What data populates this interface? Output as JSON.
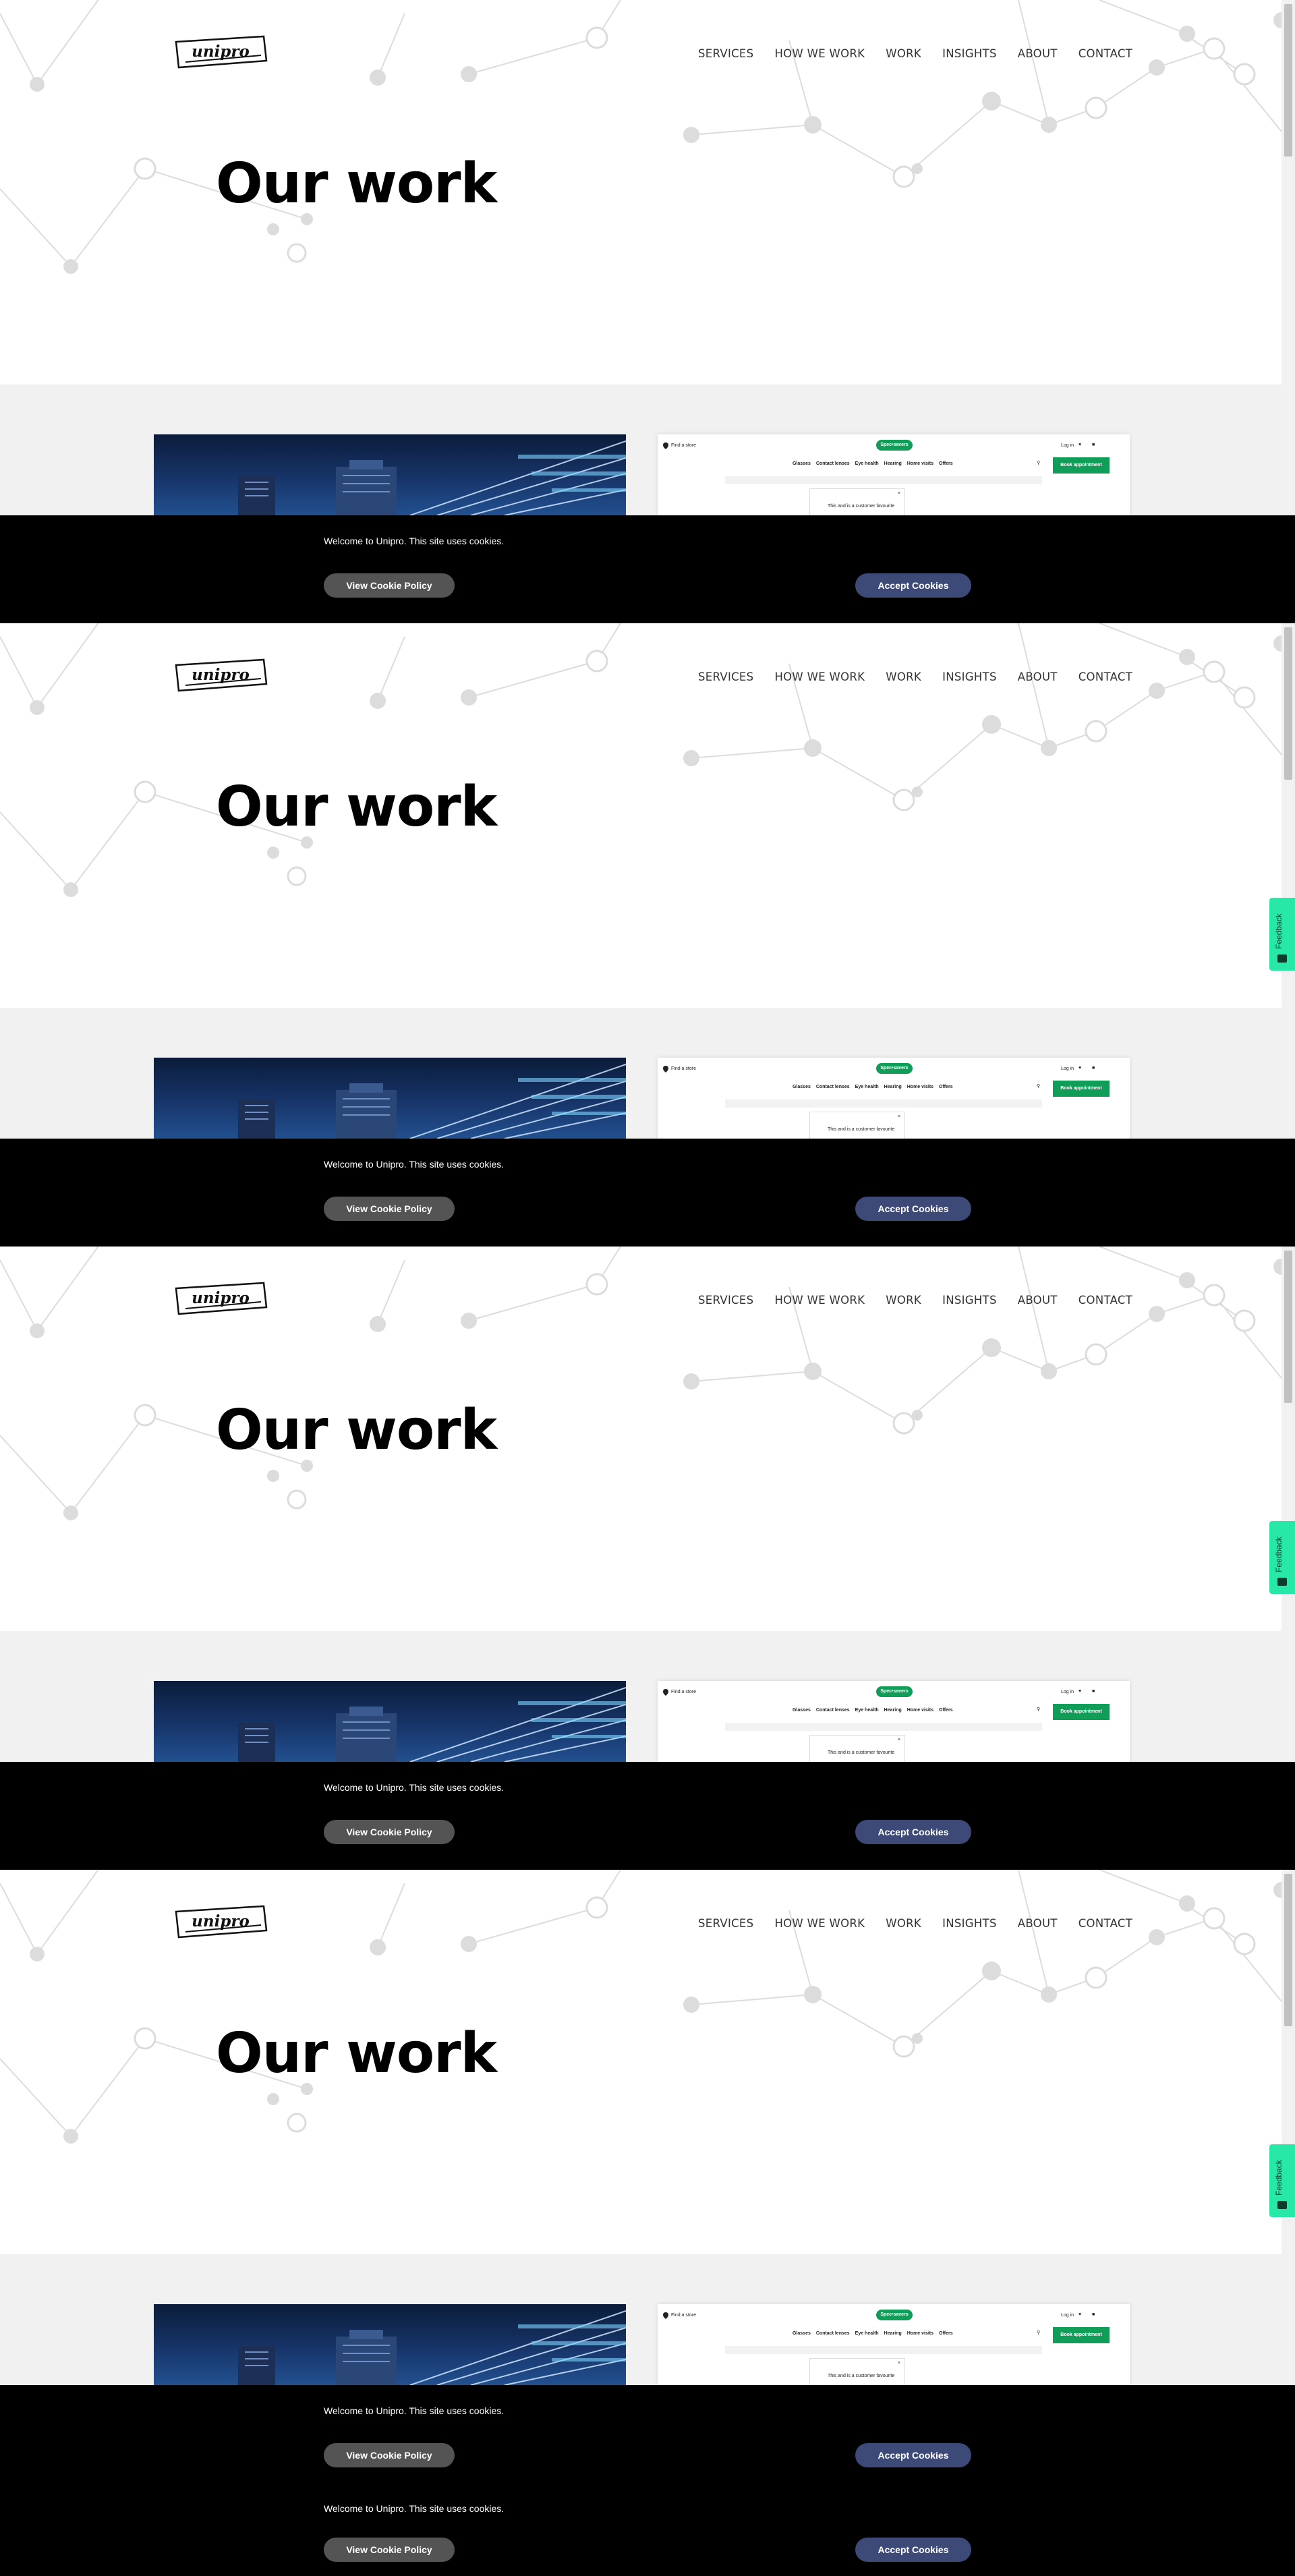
{
  "header": {
    "logo_text": "unipro",
    "nav": [
      "SERVICES",
      "HOW WE WORK",
      "WORK",
      "INSIGHTS",
      "ABOUT",
      "CONTACT"
    ]
  },
  "page_title": "Our work",
  "preview_site": {
    "store_link": "Find a store",
    "badge": "Spec•savers",
    "login": "Log in",
    "menu": [
      "Glasses",
      "Contact lenses",
      "Eye health",
      "Hearing",
      "Home visits",
      "Offers"
    ],
    "book_button": "Book appointment",
    "notice": "This and is a customer favourite"
  },
  "cookie_banner": {
    "message": "Welcome to Unipro. This site uses cookies.",
    "policy_button": "View Cookie Policy",
    "accept_button": "Accept Cookies"
  },
  "feedback_tab": {
    "label": "Feedback"
  },
  "colors": {
    "hero_bg": "#ffffff",
    "section_bg": "#f1f1f1",
    "banner_bg": "#000000",
    "policy_button_bg": "#545454",
    "accept_button_bg": "#3d4a78",
    "feedback_bg": "#27e8a7",
    "preview_green": "#0f9d58"
  }
}
